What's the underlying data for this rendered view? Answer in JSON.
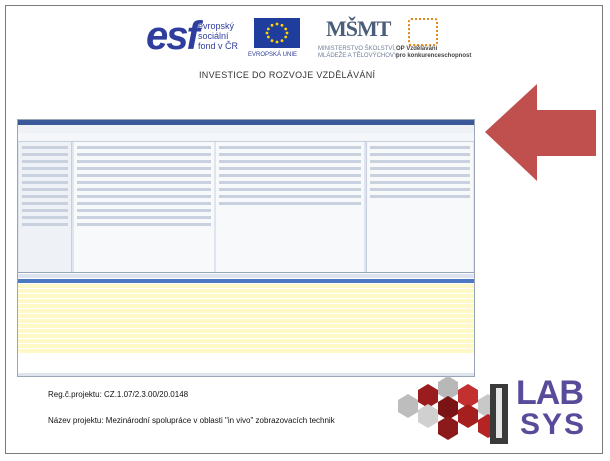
{
  "header": {
    "esf_mark": "esf",
    "esf_text_1": "evropský",
    "esf_text_2": "sociální",
    "esf_text_3": "fond v ČR",
    "eu_text": "EVROPSKÁ UNIE",
    "msmt_mark": "MŠMT",
    "msmt_text_1": "MINISTERSTVO ŠKOLSTVÍ,",
    "msmt_text_2": "MLÁDEŽE A TĚLOVÝCHOVY",
    "op_text_1": "OP Vzdělávání",
    "op_text_2": "pro konkurenceschopnost",
    "tagline": "INVESTICE DO ROZVOJE VZDĚLÁVÁNÍ"
  },
  "colors": {
    "arrow": "#c0504d",
    "brand_blue": "#2f3d9c",
    "lab_purple": "#5a4a9a"
  },
  "lab_logo": {
    "line1": "LAB",
    "line2": "SYS"
  },
  "footer": {
    "registration": "Reg.č.projektu: CZ.1.07/2.3.00/20.0148",
    "project_name": "Název projektu: Mezinárodní spolupráce v oblasti \"in vivo\" zobrazovacích technik"
  }
}
